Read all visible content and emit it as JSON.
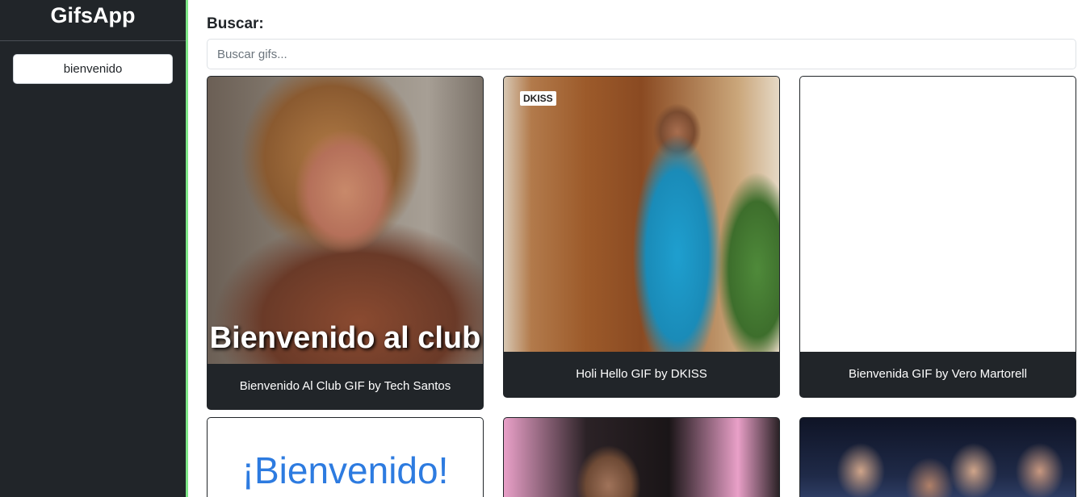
{
  "app": {
    "title": "GifsApp"
  },
  "sidebar": {
    "history": [
      {
        "label": "bienvenido"
      }
    ]
  },
  "search": {
    "label": "Buscar:",
    "placeholder": "Buscar gifs...",
    "value": ""
  },
  "gifs": [
    {
      "title": "Bienvenido Al Club GIF by Tech Santos",
      "overlay_text": "Bienvenido al club"
    },
    {
      "title": "Holi Hello GIF by DKISS",
      "watermark": "DKISS"
    },
    {
      "title": "Bienvenida GIF by Vero Martorell"
    },
    {
      "title": "",
      "overlay_text": "¡Bienvenido!"
    },
    {
      "title": ""
    },
    {
      "title": ""
    }
  ],
  "colors": {
    "sidebar_bg": "#212529",
    "sidebar_accent_border": "#7ee787",
    "card_bg": "#212529",
    "text_light": "#ffffff"
  }
}
